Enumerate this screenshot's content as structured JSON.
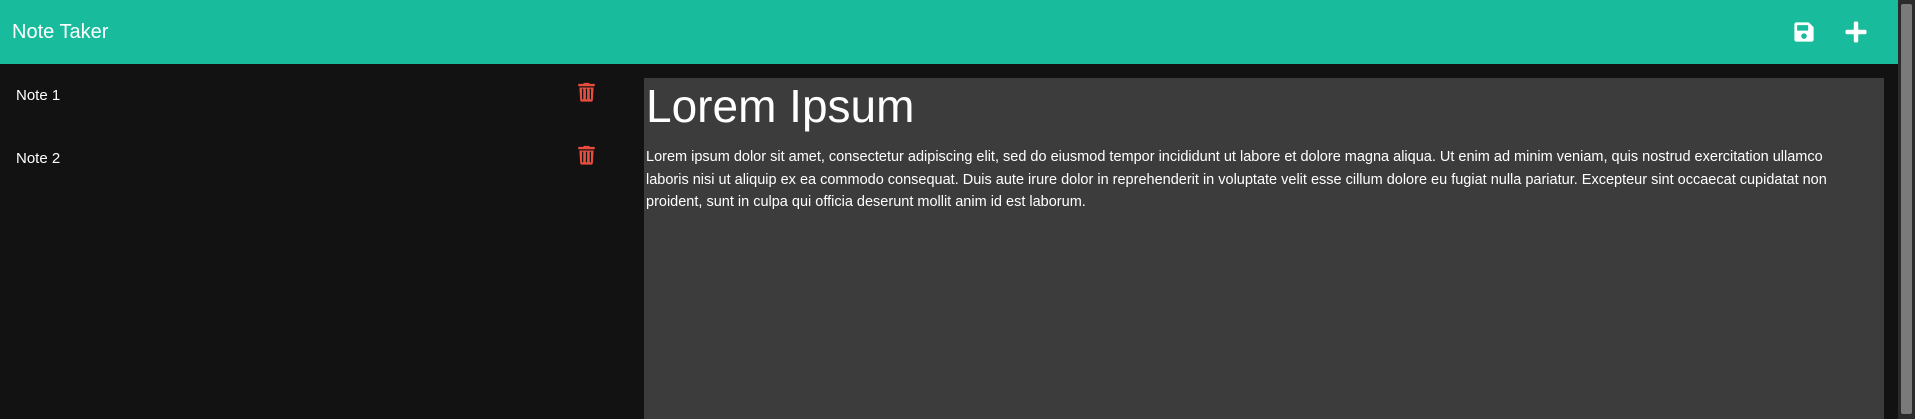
{
  "navbar": {
    "brand": "Note Taker",
    "save_icon": "floppy-disk-icon",
    "add_icon": "plus-icon",
    "color": "#18bc9c"
  },
  "sidebar": {
    "notes": [
      {
        "title": "Note 1",
        "delete_icon": "trash-icon"
      },
      {
        "title": "Note 2",
        "delete_icon": "trash-icon"
      }
    ],
    "delete_color": "#e74c3c"
  },
  "editor": {
    "title": "Lorem Ipsum",
    "body": "Lorem ipsum dolor sit amet, consectetur adipiscing elit, sed do eiusmod tempor incididunt ut labore et dolore magna aliqua. Ut enim ad minim veniam, quis nostrud exercitation ullamco laboris nisi ut aliquip ex ea commodo consequat. Duis aute irure dolor in reprehenderit in voluptate velit esse cillum dolore eu fugiat nulla pariatur. Excepteur sint occaecat cupidatat non proident, sunt in culpa qui officia deserunt mollit anim id est laborum.",
    "background": "#3c3c3c"
  }
}
